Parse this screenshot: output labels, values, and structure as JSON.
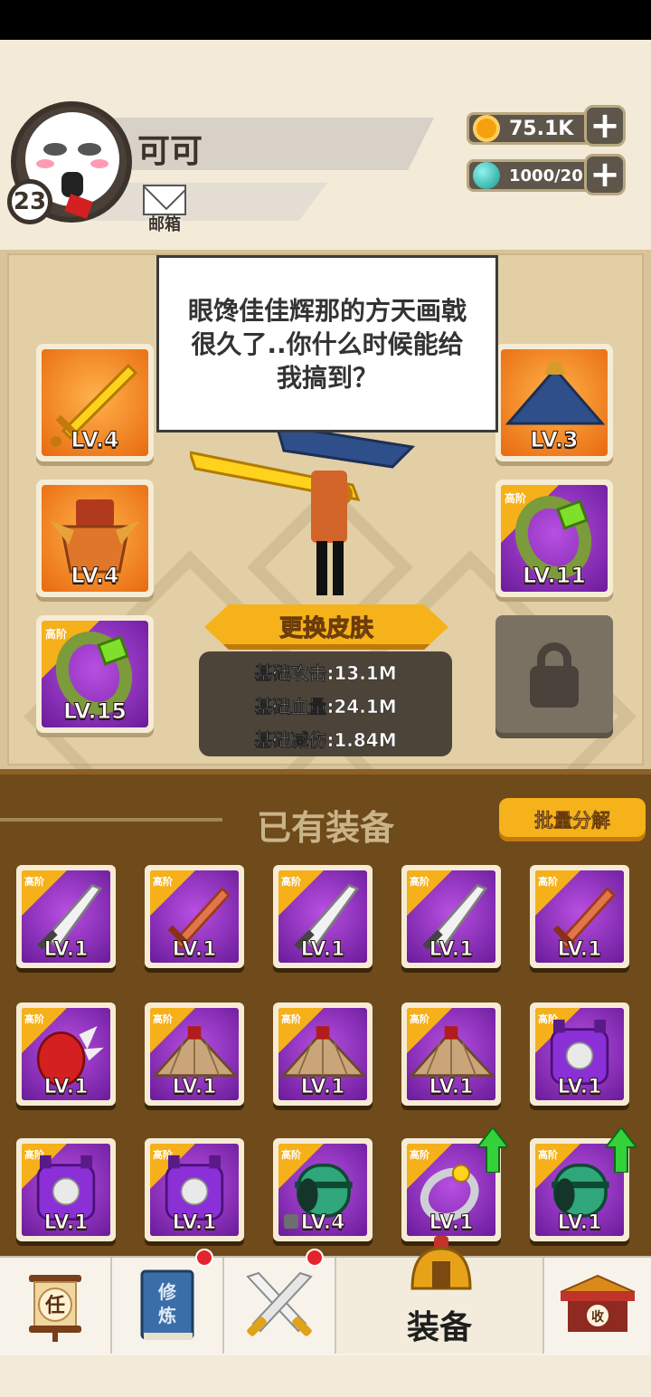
{
  "header": {
    "player_name": "可可",
    "player_level": "23",
    "mail_label": "邮箱",
    "gold_value": "75.1K",
    "gem_value": "1000/20",
    "gold_icon": "coin-icon",
    "gem_icon": "gem-icon"
  },
  "dialog": {
    "text": "眼馋佳佳辉那的方天画戟很久了..你什么时候能给我搞到？"
  },
  "equipped": {
    "rank_label": "高阶",
    "left": [
      {
        "icon": "golden-sword-icon",
        "level": "LV.4"
      },
      {
        "icon": "orange-armor-icon",
        "level": "LV.4"
      },
      {
        "icon": "green-ring-icon",
        "level": "LV.15",
        "high_rank": true
      }
    ],
    "right": [
      {
        "icon": "straw-hat-icon",
        "level": "LV.3"
      },
      {
        "icon": "green-ring-icon",
        "level": "LV.11",
        "high_rank": true
      },
      {
        "icon": "lock-icon",
        "locked": true
      }
    ]
  },
  "skin_button": "更换皮肤",
  "stats": {
    "attack": "基础攻击:13.1M",
    "hp": "基础血量:24.1M",
    "reduction": "基础减伤:1.84M"
  },
  "inventory": {
    "title": "已有装备",
    "batch_button": "批量分解",
    "rank_label": "高阶",
    "items": [
      {
        "icon": "saber-icon",
        "level": "LV.1"
      },
      {
        "icon": "wooden-sword-icon",
        "level": "LV.1"
      },
      {
        "icon": "saber-icon",
        "level": "LV.1"
      },
      {
        "icon": "saber-icon",
        "level": "LV.1"
      },
      {
        "icon": "wooden-sword-icon",
        "level": "LV.1"
      },
      {
        "icon": "red-gauntlet-icon",
        "level": "LV.1"
      },
      {
        "icon": "straw-hat-icon",
        "level": "LV.1"
      },
      {
        "icon": "straw-hat-icon",
        "level": "LV.1"
      },
      {
        "icon": "straw-hat-icon",
        "level": "LV.1"
      },
      {
        "icon": "purple-armor-icon",
        "level": "LV.1"
      },
      {
        "icon": "purple-armor-icon",
        "level": "LV.1"
      },
      {
        "icon": "purple-armor-icon",
        "level": "LV.1"
      },
      {
        "icon": "jade-bracer-icon",
        "level": "LV.4",
        "locked": true
      },
      {
        "icon": "silver-ring-icon",
        "level": "LV.1",
        "upgradable": true
      },
      {
        "icon": "jade-bracer-icon",
        "level": "LV.1",
        "upgradable": true
      }
    ]
  },
  "nav": {
    "tab_task": "任",
    "tab_cultivate_top": "修",
    "tab_cultivate_bottom": "炼",
    "tab_equip": "装备",
    "tab_collect": "收"
  },
  "colors": {
    "panel": "#e2cfa6",
    "inventory_bg": "#6f4a1b",
    "accent": "#f6b21b",
    "rarity_purple": "#8e2fc0",
    "rarity_orange": "#f08a20",
    "badge_red": "#e5232c"
  }
}
